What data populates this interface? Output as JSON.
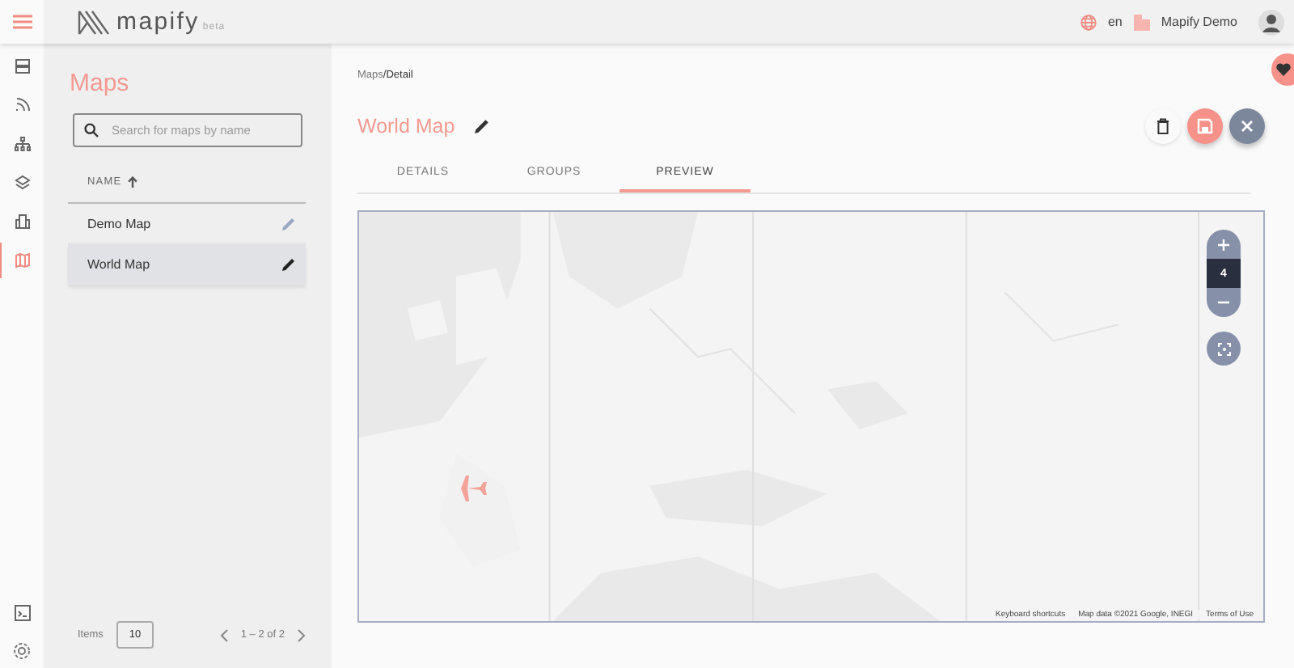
{
  "topbar": {
    "logo_text": "mapify",
    "logo_badge": "beta",
    "language": "en",
    "user_name": "Mapify Demo"
  },
  "rail": {
    "items": [
      {
        "selected": false
      },
      {
        "selected": false
      },
      {
        "selected": false
      },
      {
        "selected": false
      },
      {
        "selected": false
      },
      {
        "selected": true
      }
    ]
  },
  "sidebar": {
    "title": "Maps",
    "search": {
      "placeholder": "Search for maps by name"
    },
    "column": "NAME",
    "rows": [
      {
        "name": "Demo Map",
        "selected": false
      },
      {
        "name": "World Map",
        "selected": true
      }
    ],
    "footer": {
      "items_label": "Items",
      "page_size": "10",
      "range": "1 – 2 of 2"
    }
  },
  "main": {
    "breadcrumb": {
      "parent": "Maps",
      "separator": "/",
      "current": "Detail"
    },
    "title": "World Map",
    "tabs": [
      {
        "label": "DETAILS",
        "selected": false
      },
      {
        "label": "GROUPS",
        "selected": false
      },
      {
        "label": "PREVIEW",
        "selected": true
      }
    ],
    "map": {
      "zoom": "4",
      "attribution": [
        "Keyboard shortcuts",
        "Map data ©2021 Google, INEGI",
        "Terms of Use"
      ]
    }
  }
}
